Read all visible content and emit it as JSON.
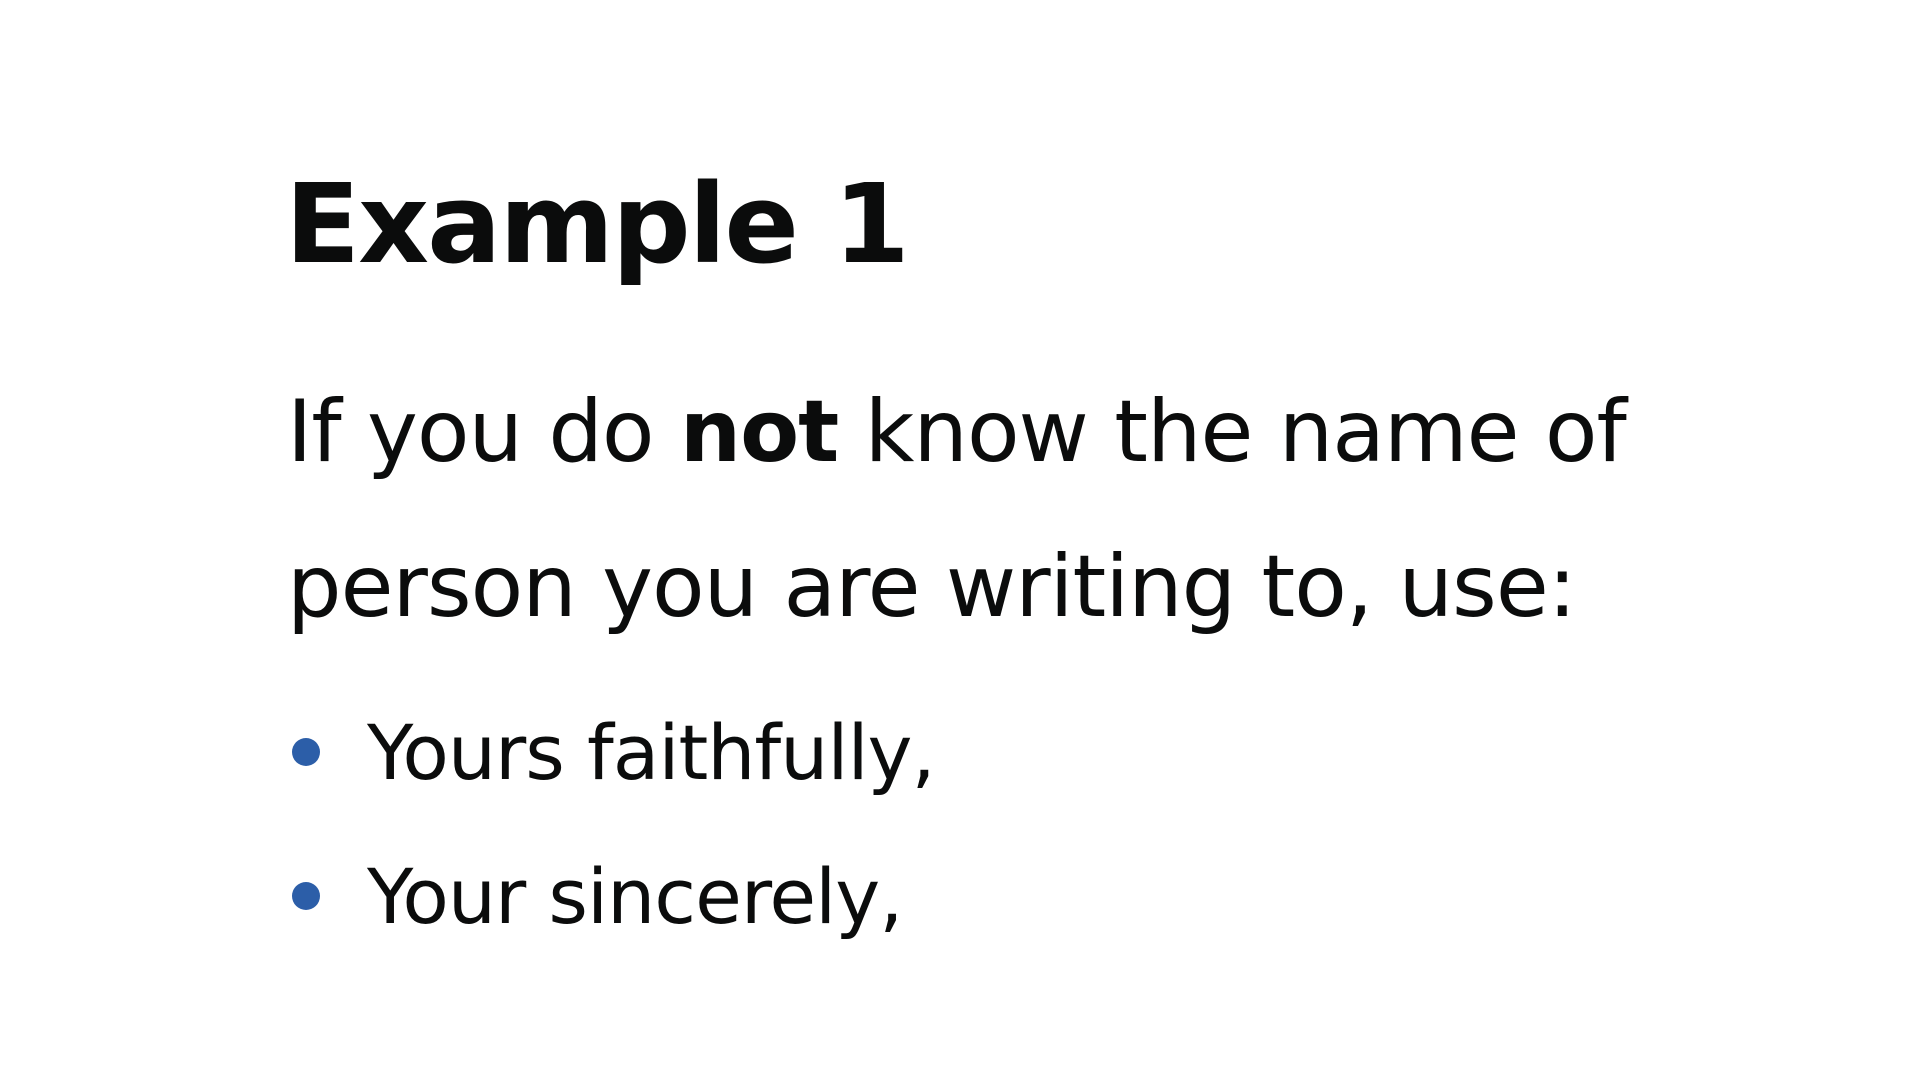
{
  "heading": "Example 1",
  "intro": {
    "line1_before": "If you do ",
    "line1_bold": "not",
    "line1_after": " know the name of",
    "line2": "person you are writing to, use:"
  },
  "list": {
    "items": [
      {
        "label": "Yours faithfully,"
      },
      {
        "label": "Your sincerely,"
      }
    ]
  },
  "colors": {
    "text": "#0b0c0c",
    "bullet": "#2c5ea8",
    "background": "#ffffff"
  }
}
